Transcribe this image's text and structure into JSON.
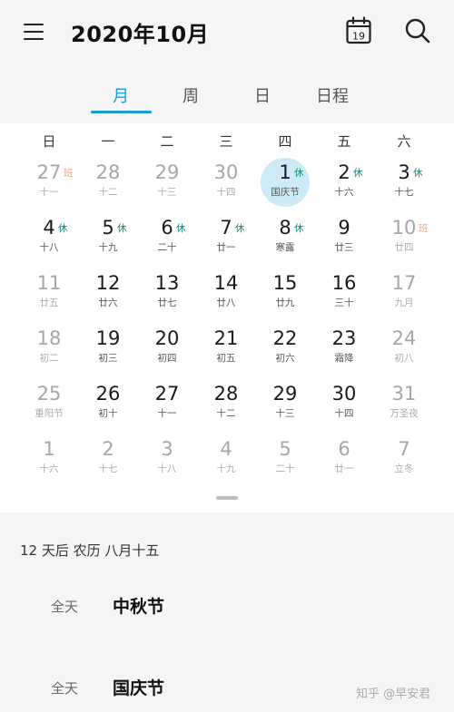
{
  "header": {
    "title": "2020年10月",
    "calendar_icon_day": "19"
  },
  "tabs": [
    {
      "label": "月",
      "active": true
    },
    {
      "label": "周",
      "active": false
    },
    {
      "label": "日",
      "active": false
    },
    {
      "label": "日程",
      "active": false
    }
  ],
  "weekdays": [
    "日",
    "一",
    "二",
    "三",
    "四",
    "五",
    "六"
  ],
  "weeks": [
    [
      {
        "day": "27",
        "lunar": "十一",
        "tag": "班",
        "faded": true
      },
      {
        "day": "28",
        "lunar": "十二",
        "tag": "",
        "faded": true
      },
      {
        "day": "29",
        "lunar": "十三",
        "tag": "",
        "faded": true
      },
      {
        "day": "30",
        "lunar": "十四",
        "tag": "",
        "faded": true
      },
      {
        "day": "1",
        "lunar": "国庆节",
        "tag": "休",
        "faded": false,
        "today": true
      },
      {
        "day": "2",
        "lunar": "十六",
        "tag": "休",
        "faded": false
      },
      {
        "day": "3",
        "lunar": "十七",
        "tag": "休",
        "faded": false
      }
    ],
    [
      {
        "day": "4",
        "lunar": "十八",
        "tag": "休",
        "faded": false
      },
      {
        "day": "5",
        "lunar": "十九",
        "tag": "休",
        "faded": false
      },
      {
        "day": "6",
        "lunar": "二十",
        "tag": "休",
        "faded": false
      },
      {
        "day": "7",
        "lunar": "廿一",
        "tag": "休",
        "faded": false
      },
      {
        "day": "8",
        "lunar": "寒露",
        "tag": "休",
        "faded": false
      },
      {
        "day": "9",
        "lunar": "廿三",
        "tag": "",
        "faded": false
      },
      {
        "day": "10",
        "lunar": "廿四",
        "tag": "班",
        "faded": true
      }
    ],
    [
      {
        "day": "11",
        "lunar": "廿五",
        "tag": "",
        "faded": true
      },
      {
        "day": "12",
        "lunar": "廿六",
        "tag": "",
        "faded": false
      },
      {
        "day": "13",
        "lunar": "廿七",
        "tag": "",
        "faded": false
      },
      {
        "day": "14",
        "lunar": "廿八",
        "tag": "",
        "faded": false
      },
      {
        "day": "15",
        "lunar": "廿九",
        "tag": "",
        "faded": false
      },
      {
        "day": "16",
        "lunar": "三十",
        "tag": "",
        "faded": false
      },
      {
        "day": "17",
        "lunar": "九月",
        "tag": "",
        "faded": true
      }
    ],
    [
      {
        "day": "18",
        "lunar": "初二",
        "tag": "",
        "faded": true
      },
      {
        "day": "19",
        "lunar": "初三",
        "tag": "",
        "faded": false
      },
      {
        "day": "20",
        "lunar": "初四",
        "tag": "",
        "faded": false
      },
      {
        "day": "21",
        "lunar": "初五",
        "tag": "",
        "faded": false
      },
      {
        "day": "22",
        "lunar": "初六",
        "tag": "",
        "faded": false
      },
      {
        "day": "23",
        "lunar": "霜降",
        "tag": "",
        "faded": false
      },
      {
        "day": "24",
        "lunar": "初八",
        "tag": "",
        "faded": true
      }
    ],
    [
      {
        "day": "25",
        "lunar": "重阳节",
        "tag": "",
        "faded": true
      },
      {
        "day": "26",
        "lunar": "初十",
        "tag": "",
        "faded": false
      },
      {
        "day": "27",
        "lunar": "十一",
        "tag": "",
        "faded": false
      },
      {
        "day": "28",
        "lunar": "十二",
        "tag": "",
        "faded": false
      },
      {
        "day": "29",
        "lunar": "十三",
        "tag": "",
        "faded": false
      },
      {
        "day": "30",
        "lunar": "十四",
        "tag": "",
        "faded": false
      },
      {
        "day": "31",
        "lunar": "万圣夜",
        "tag": "",
        "faded": true
      }
    ],
    [
      {
        "day": "1",
        "lunar": "十六",
        "tag": "",
        "faded": true
      },
      {
        "day": "2",
        "lunar": "十七",
        "tag": "",
        "faded": true
      },
      {
        "day": "3",
        "lunar": "十八",
        "tag": "",
        "faded": true
      },
      {
        "day": "4",
        "lunar": "十九",
        "tag": "",
        "faded": true
      },
      {
        "day": "5",
        "lunar": "二十",
        "tag": "",
        "faded": true
      },
      {
        "day": "6",
        "lunar": "廿一",
        "tag": "",
        "faded": true
      },
      {
        "day": "7",
        "lunar": "立冬",
        "tag": "",
        "faded": true
      }
    ]
  ],
  "agenda": {
    "countdown": "12 天后  农历 八月十五",
    "events": [
      {
        "time": "全天",
        "name": "中秋节"
      },
      {
        "time": "全天",
        "name": "国庆节"
      }
    ]
  },
  "watermark": "知乎 @早安君",
  "colors": {
    "accent": "#1a9bd7",
    "rest_tag": "#0d8a7a",
    "work_tag": "#d86a3c",
    "today_bg": "#cdeaf6"
  },
  "icons": [
    "menu-icon",
    "calendar-icon",
    "search-icon"
  ]
}
